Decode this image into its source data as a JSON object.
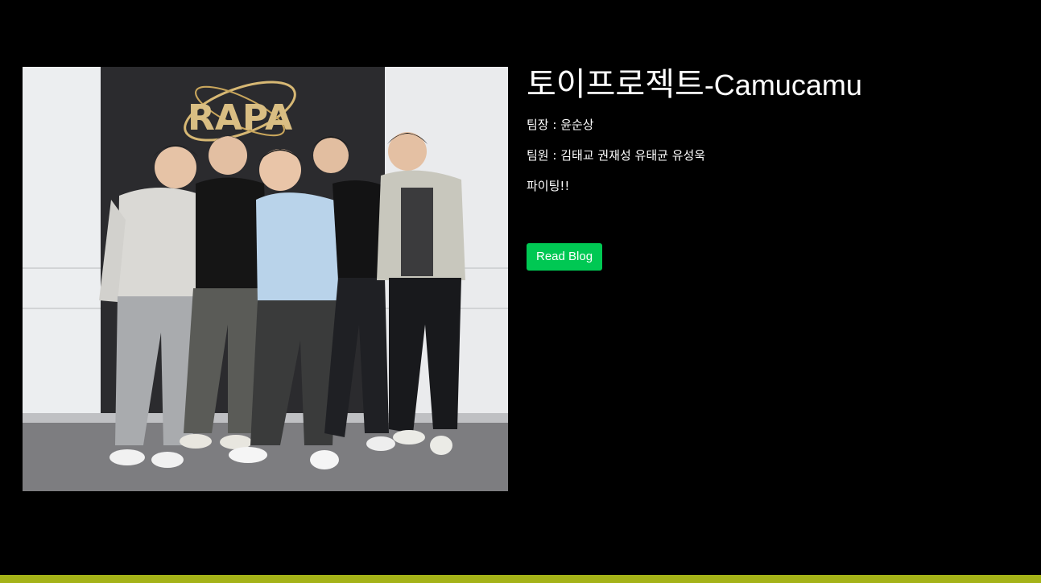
{
  "project": {
    "title_korean": "토이프로젝트",
    "title_english": "-Camucamu",
    "leader": "팀장 : 윤순상",
    "members": "팀원 : 김태교 권재성 유태균 유성욱",
    "cheer": "파이팅!!",
    "button_label": "Read Blog"
  },
  "photo": {
    "sign_text": "RAPA",
    "description_alt": "team-photo"
  },
  "colors": {
    "background": "#000000",
    "button": "#00c853",
    "bottom_bar": "#a5b318",
    "text": "#ffffff"
  }
}
